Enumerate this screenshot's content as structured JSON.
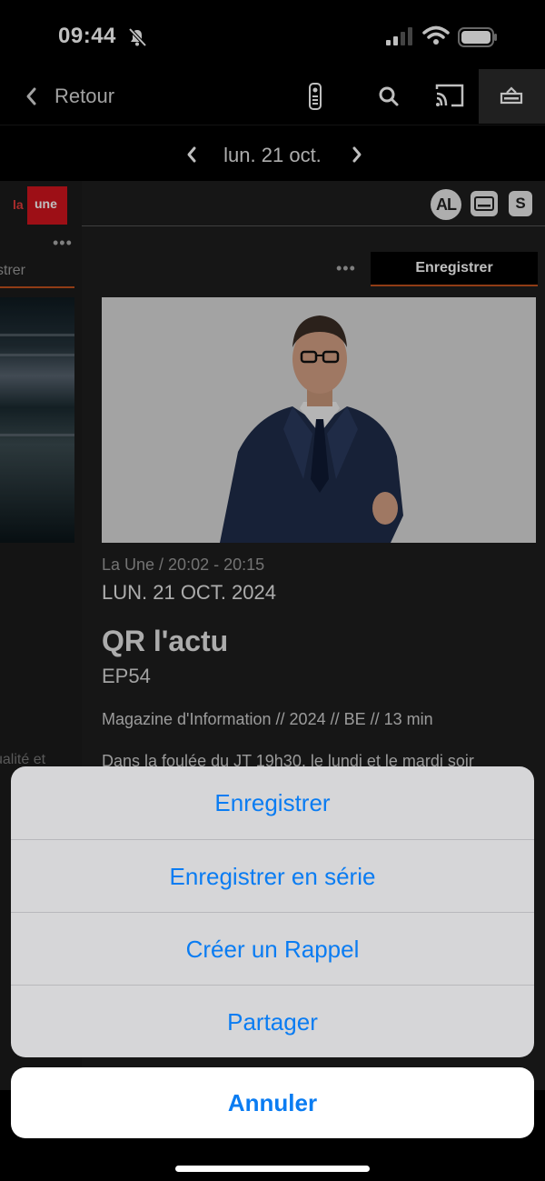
{
  "status_bar": {
    "time": "09:44"
  },
  "nav": {
    "back_label": "Retour"
  },
  "date_selector": {
    "date": "lun. 21 oct."
  },
  "left_channel": {
    "logo_la": "la",
    "logo_une": "une",
    "more": "•••",
    "record_partial": "strer",
    "desc_partial": "ualité et"
  },
  "program": {
    "accessibility": {
      "al": "AL",
      "s": "S"
    },
    "more": "•••",
    "record_button": "Enregistrer",
    "channel_time": "La Une / 20:02 - 20:15",
    "date": "LUN. 21 OCT. 2024",
    "title": "QR l'actu",
    "episode": "EP54",
    "info": "Magazine d'Information // 2024 // BE // 13 min",
    "description": "Dans la foulée du JT 19h30, le lundi et le mardi soir"
  },
  "action_sheet": {
    "items": [
      "Enregistrer",
      "Enregistrer en série",
      "Créer un Rappel",
      "Partager"
    ],
    "cancel": "Annuler"
  },
  "colors": {
    "accent": "#0a7cf2",
    "brand_red": "#d2141e",
    "record_underline": "#c0501e"
  }
}
